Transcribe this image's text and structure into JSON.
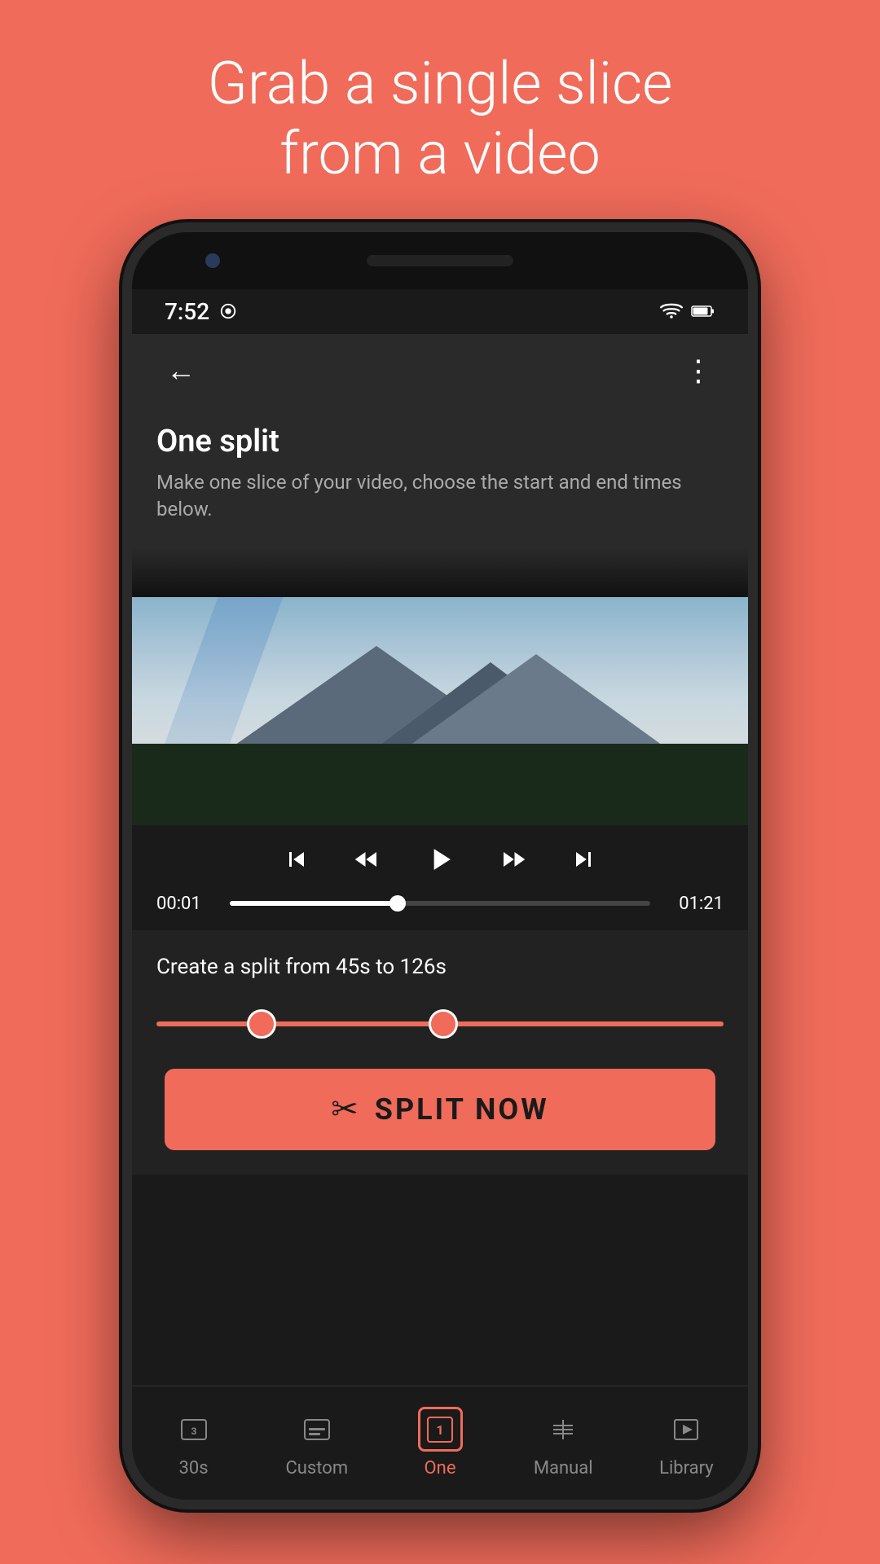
{
  "hero": {
    "line1": "Grab a single slice",
    "line2": "from a video"
  },
  "status_bar": {
    "time": "7:52",
    "wifi": "▼",
    "battery": "🔋"
  },
  "app_bar": {
    "back_label": "←",
    "more_label": "⋮"
  },
  "page": {
    "title": "One split",
    "subtitle": "Make one slice of your video, choose the start and end times below."
  },
  "player": {
    "time_start": "00:01",
    "time_end": "01:21",
    "progress_pct": 40
  },
  "split": {
    "label": "Create a split from 45s to 126s",
    "thumb_left_pct": 17,
    "thumb_right_pct": 49,
    "button_label": "SPLIT NOW"
  },
  "bottom_nav": {
    "items": [
      {
        "id": "30s",
        "label": "30s",
        "active": false
      },
      {
        "id": "custom",
        "label": "Custom",
        "active": false
      },
      {
        "id": "one",
        "label": "One",
        "active": true
      },
      {
        "id": "manual",
        "label": "Manual",
        "active": false
      },
      {
        "id": "library",
        "label": "Library",
        "active": false
      }
    ]
  },
  "colors": {
    "accent": "#F06B5A",
    "bg_dark": "#1a1a1a",
    "bg_medium": "#2a2a2a",
    "text_primary": "#ffffff",
    "text_secondary": "#aaaaaa"
  }
}
